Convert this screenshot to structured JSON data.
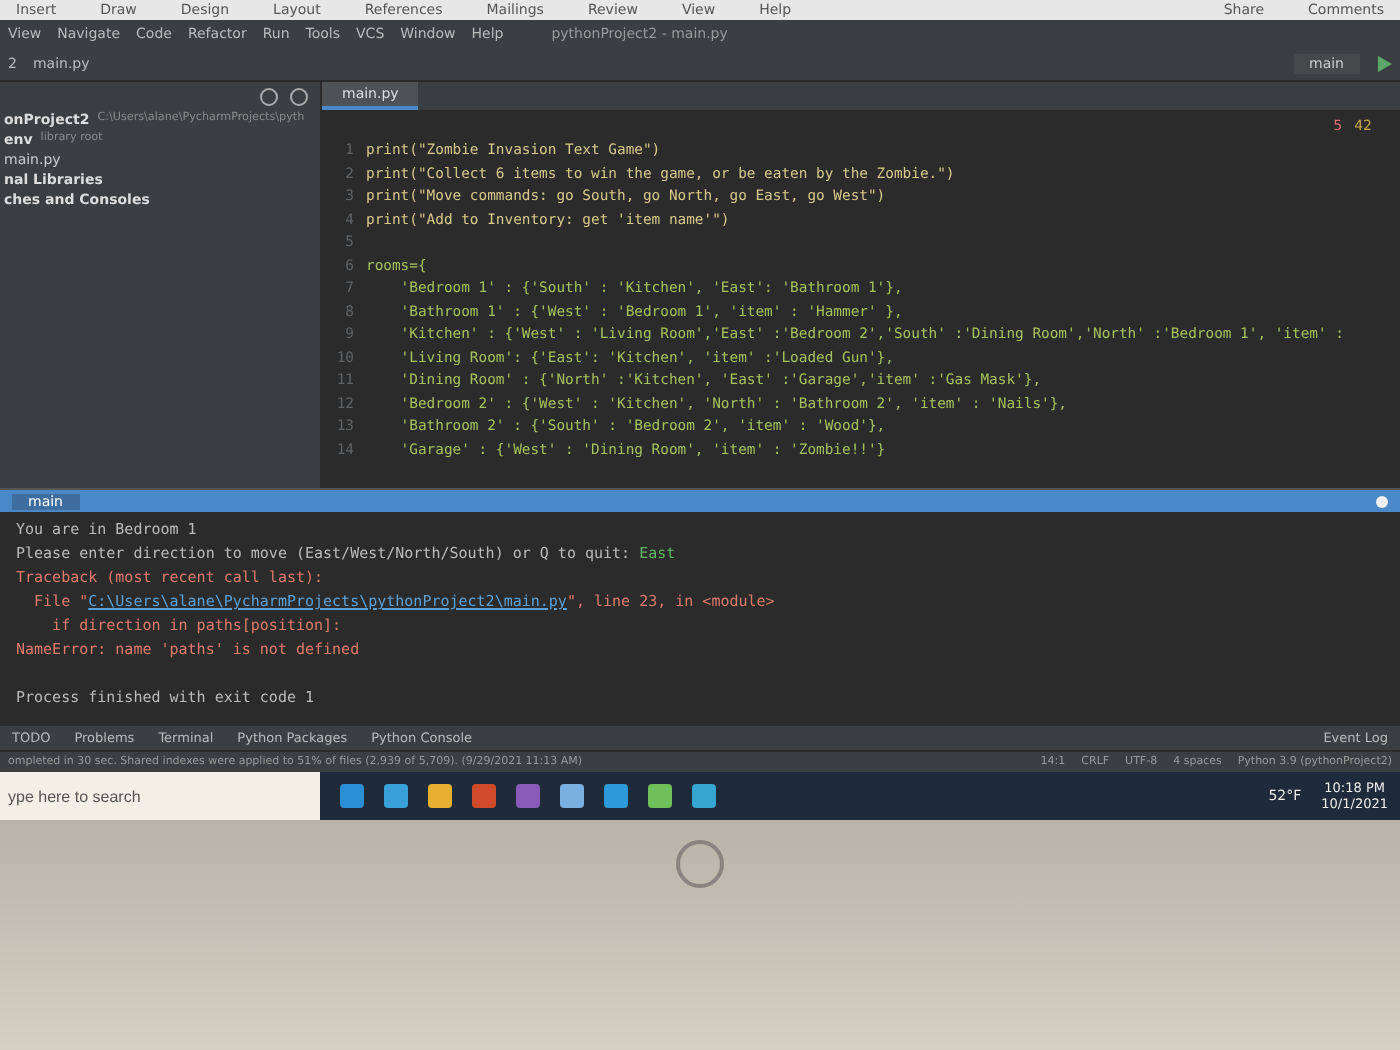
{
  "word_ribbon": {
    "tabs": [
      "Insert",
      "Draw",
      "Design",
      "Layout",
      "References",
      "Mailings",
      "Review",
      "View",
      "Help"
    ],
    "share": "Share",
    "comments": "Comments"
  },
  "menu_bar": {
    "items": [
      "View",
      "Navigate",
      "Code",
      "Refactor",
      "Run",
      "Tools",
      "VCS",
      "Window",
      "Help"
    ],
    "title": "pythonProject2 - main.py"
  },
  "nav_bar": {
    "crumbs": [
      "2",
      "main.py"
    ],
    "run_config": "main"
  },
  "project_panel": {
    "items": [
      {
        "label": "onProject2",
        "note": "C:\\Users\\alane\\PycharmProjects\\pyth",
        "kind": "folder"
      },
      {
        "label": "env",
        "note": "library root",
        "kind": "folder"
      },
      {
        "label": "main.py",
        "kind": "file"
      },
      {
        "label": "nal Libraries",
        "kind": "folder"
      },
      {
        "label": "ches and Consoles",
        "kind": "folder"
      }
    ]
  },
  "editor": {
    "tab": "main.py",
    "errors": "5",
    "warnings": "42",
    "lines": [
      {
        "number": "1",
        "code": "print(\"Zombie Invasion Text Game\")"
      },
      {
        "number": "2",
        "code": "print(\"Collect 6 items to win the game, or be eaten by the Zombie.\")"
      },
      {
        "number": "3",
        "code": "print(\"Move commands: go South, go North, go East, go West\")"
      },
      {
        "number": "4",
        "code": "print(\"Add to Inventory: get 'item name'\")"
      },
      {
        "number": "5"
      },
      {
        "number": "6",
        "code": "rooms={"
      },
      {
        "number": "7",
        "code": "    'Bedroom 1' : {'South' : 'Kitchen', 'East': 'Bathroom 1'},"
      },
      {
        "number": "8",
        "code": "    'Bathroom 1' : {'West' : 'Bedroom 1', 'item' : 'Hammer' },"
      },
      {
        "number": "9",
        "code": "    'Kitchen' : {'West' : 'Living Room','East' :'Bedroom 2','South' :'Dining Room','North' :'Bedroom 1', 'item' :"
      },
      {
        "number": "10",
        "code": "    'Living Room': {'East': 'Kitchen', 'item' :'Loaded Gun'},"
      },
      {
        "number": "11",
        "code": "    'Dining Room' : {'North' :'Kitchen', 'East' :'Garage','item' :'Gas Mask'},"
      },
      {
        "number": "12",
        "code": "    'Bedroom 2' : {'West' : 'Kitchen', 'North' : 'Bathroom 2', 'item' : 'Nails'},"
      },
      {
        "number": "13",
        "code": "    'Bathroom 2' : {'South' : 'Bedroom 2', 'item' : 'Wood'},"
      },
      {
        "number": "14",
        "code": "    'Garage' : {'West' : 'Dining Room', 'item' : 'Zombie!!'}"
      }
    ]
  },
  "run_panel": {
    "tab": "main",
    "lines": [
      {
        "kind": "output",
        "segments": [
          {
            "kind": "plain",
            "text": "You are in Bedroom 1"
          }
        ]
      },
      {
        "kind": "output",
        "segments": [
          {
            "kind": "plain",
            "text": "Please enter direction to move (East/West/North/South) or Q to quit: "
          },
          {
            "kind": "input",
            "text": "East"
          }
        ]
      },
      {
        "kind": "output",
        "segments": [
          {
            "kind": "error",
            "text": "Traceback (most recent call last):"
          }
        ]
      },
      {
        "kind": "output",
        "segments": [
          {
            "kind": "error",
            "text": "  File \""
          },
          {
            "kind": "link",
            "text": "C:\\Users\\alane\\PycharmProjects\\pythonProject2\\main.py"
          },
          {
            "kind": "error",
            "text": "\", line 23, in <module>"
          }
        ]
      },
      {
        "kind": "output",
        "segments": [
          {
            "kind": "error",
            "text": "    if direction in paths[position]:"
          }
        ]
      },
      {
        "kind": "output",
        "segments": [
          {
            "kind": "error",
            "text": "NameError: name 'paths' is not defined"
          }
        ]
      },
      {
        "kind": "exit",
        "segments": [
          {
            "kind": "plain",
            "text": "Process finished with exit code 1"
          }
        ]
      }
    ]
  },
  "tool_strip": {
    "tabs": [
      "TODO",
      "Problems",
      "Terminal",
      "Python Packages",
      "Python Console"
    ],
    "event_log": "Event Log"
  },
  "status_bar": {
    "message": "ompleted in 30 sec. Shared indexes were applied to 51% of files (2,939 of 5,709). (9/29/2021 11:13 AM)",
    "items": [
      "14:1",
      "CRLF",
      "UTF-8",
      "4 spaces",
      "Python 3.9 (pythonProject2)"
    ]
  },
  "taskbar": {
    "search_placeholder": "ype here to search",
    "weather": "52°F",
    "time": "10:18 PM",
    "date": "10/1/2021"
  }
}
